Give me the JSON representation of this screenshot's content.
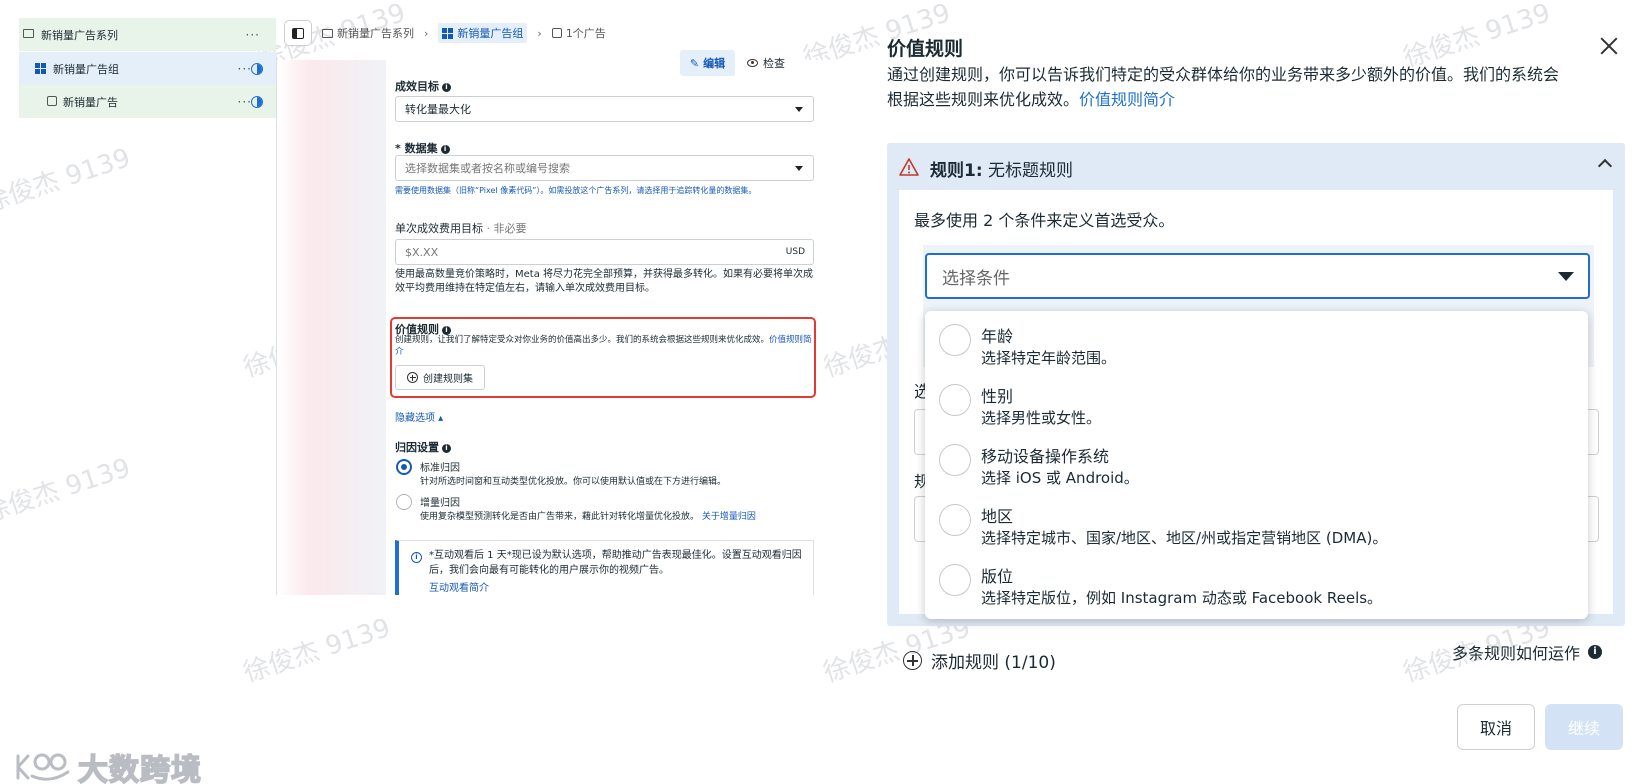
{
  "tree": {
    "campaign": "新销量广告系列",
    "adset": "新销量广告组",
    "ad": "新销量广告",
    "more": "···"
  },
  "breadcrumb": {
    "campaign": "新销量广告系列",
    "adset": "新销量广告组",
    "ads": "1个广告"
  },
  "toolbar": {
    "edit": "编辑",
    "inspect": "检查"
  },
  "form": {
    "goal_label": "成效目标",
    "goal_value": "转化量最大化",
    "dataset_label": "* 数据集",
    "dataset_placeholder": "选择数据集或者按名称或编号搜索",
    "dataset_help": "需要使用数据集（旧称“Pixel 像素代码”）。如需投放这个广告系列，请选择用于追踪转化量的数据集。",
    "cost_label": "单次成效费用目标",
    "cost_optional": "· 非必要",
    "cost_placeholder": "$X.XX",
    "cost_currency": "USD",
    "cost_help": "使用最高数量竞价策略时，Meta 将尽力花完全部预算，并获得最多转化。如果有必要将单次成效平均费用维持在特定值左右，请输入单次成效费用目标。",
    "value_rule_label": "价值规则",
    "value_rule_help": "创建规则，让我们了解特定受众对你业务的价值高出多少。我们的系统会根据这些规则来优化成效。",
    "value_rule_link": "价值规则简介",
    "create_ruleset": "创建规则集",
    "hide_options": "隐藏选项 ▴",
    "attribution_label": "归因设置",
    "attr_standard_title": "标准归因",
    "attr_standard_desc": "针对所选时间窗和互动类型优化投放。你可以使用默认值或在下方进行编辑。",
    "attr_incremental_title": "增量归因",
    "attr_incremental_desc": "使用复杂模型预测转化是否由广告带来，藉此针对转化增量优化投放。",
    "attr_incremental_link": "关于增量归因",
    "notice_text": "*互动观看后 1 天*现已设为默认选项，帮助推动广告表现最佳化。设置互动观看归因后，我们会向最有可能转化的用户展示你的视频广告。",
    "notice_link": "互动观看简介"
  },
  "modal": {
    "title": "价值规则",
    "desc": "通过创建规则，你可以告诉我们特定的受众群体给你的业务带来多少额外的价值。我们的系统会根据这些规则来优化成效。",
    "desc_link": "价值规则简介",
    "rule_title_bold": "规则1:",
    "rule_title_rest": " 无标题规则",
    "instruction": "最多使用 2 个条件来定义首选受众。",
    "condition_placeholder": "选择条件",
    "ghost_label_1": "选",
    "ghost_label_2": "规",
    "options": [
      {
        "title": "年龄",
        "desc": "选择特定年龄范围。"
      },
      {
        "title": "性别",
        "desc": "选择男性或女性。"
      },
      {
        "title": "移动设备操作系统",
        "desc": "选择 iOS 或 Android。"
      },
      {
        "title": "地区",
        "desc": "选择特定城市、国家/地区、地区/州或指定营销地区 (DMA)。"
      },
      {
        "title": "版位",
        "desc": "选择特定版位，例如 Instagram 动态或 Facebook Reels。"
      }
    ],
    "add_rule": "添加规则 (1/10)",
    "how_rules_work": "多条规则如何运作",
    "cancel": "取消",
    "continue": "继续"
  },
  "watermark": "徐俊杰 9139",
  "brand": "大数跨境",
  "colors": {
    "accent": "#1f6fd1",
    "highlight": "#e53935",
    "panel": "#dfeaf6"
  }
}
